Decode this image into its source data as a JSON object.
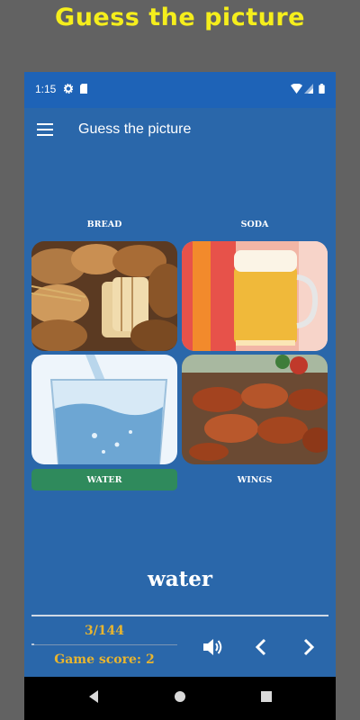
{
  "promo": {
    "title": "Guess the picture"
  },
  "status_bar": {
    "time": "1:15",
    "icons": [
      "gear-icon",
      "sd-card-icon",
      "wifi-icon",
      "signal-icon",
      "battery-icon"
    ]
  },
  "app_bar": {
    "title": "Guess the picture",
    "menu_icon": "hamburger-menu-icon"
  },
  "cards": [
    {
      "label": "BREAD",
      "image": "bread-photo"
    },
    {
      "label": "SODA",
      "image": "beer-glass-photo"
    },
    {
      "label": "WATER",
      "image": "water-glass-photo",
      "selected": true
    },
    {
      "label": "WINGS",
      "image": "chicken-wings-photo"
    }
  ],
  "answer": {
    "word": "water"
  },
  "game": {
    "progress_text": "3/144",
    "progress_fraction": 0.021,
    "score_text": "Game score:  2"
  },
  "controls": {
    "sound_icon": "volume-icon",
    "prev_icon": "chevron-left-icon",
    "next_icon": "chevron-right-icon"
  },
  "nav_bar": {
    "icons": [
      "back-triangle-icon",
      "home-circle-icon",
      "recents-square-icon"
    ]
  },
  "colors": {
    "promo_title": "#f5ee1c",
    "app_background": "#2a67aa",
    "status_bar": "#1e63b7",
    "selected_answer": "#2f8a5c",
    "score_text": "#e8b52f"
  }
}
